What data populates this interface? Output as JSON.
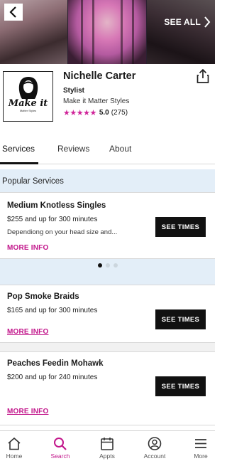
{
  "hero": {
    "see_all_label": "SEE ALL"
  },
  "profile": {
    "name": "Nichelle Carter",
    "role": "Stylist",
    "business": "Make it Matter Styles",
    "rating": "5.0",
    "review_count": "(275)",
    "stars": "★★★★★",
    "logo_text": "Make it",
    "logo_subtext": "Matter Styles"
  },
  "tabs": [
    {
      "label": "Services",
      "active": true
    },
    {
      "label": "Reviews",
      "active": false
    },
    {
      "label": "About",
      "active": false
    }
  ],
  "popular": {
    "title": "Popular Services",
    "services": [
      {
        "name": "Medium Knotless Singles",
        "price": "$255 and up for 300 minutes",
        "description": "Dependiong on your head size and...",
        "more_info": "MORE INFO",
        "action": "SEE TIMES"
      }
    ],
    "carousel_pages": 3,
    "carousel_active": 1
  },
  "services": [
    {
      "name": "Pop Smoke Braids",
      "price": "$165 and up for 300 minutes",
      "more_info": "MORE INFO",
      "action": "SEE TIMES"
    },
    {
      "name": "Peaches Feedin Mohawk",
      "price": "$200 and up for 240 minutes",
      "more_info": "MORE INFO",
      "action": "SEE TIMES"
    }
  ],
  "bottom_nav": [
    {
      "label": "Home",
      "icon": "home-icon",
      "active": false
    },
    {
      "label": "Search",
      "icon": "search-icon",
      "active": true
    },
    {
      "label": "Appts",
      "icon": "calendar-icon",
      "active": false
    },
    {
      "label": "Account",
      "icon": "account-icon",
      "active": false
    },
    {
      "label": "More",
      "icon": "menu-icon",
      "active": false
    }
  ],
  "colors": {
    "accent": "#c2168b",
    "star": "#d0259a",
    "band": "#e3eef8",
    "button": "#111111"
  }
}
